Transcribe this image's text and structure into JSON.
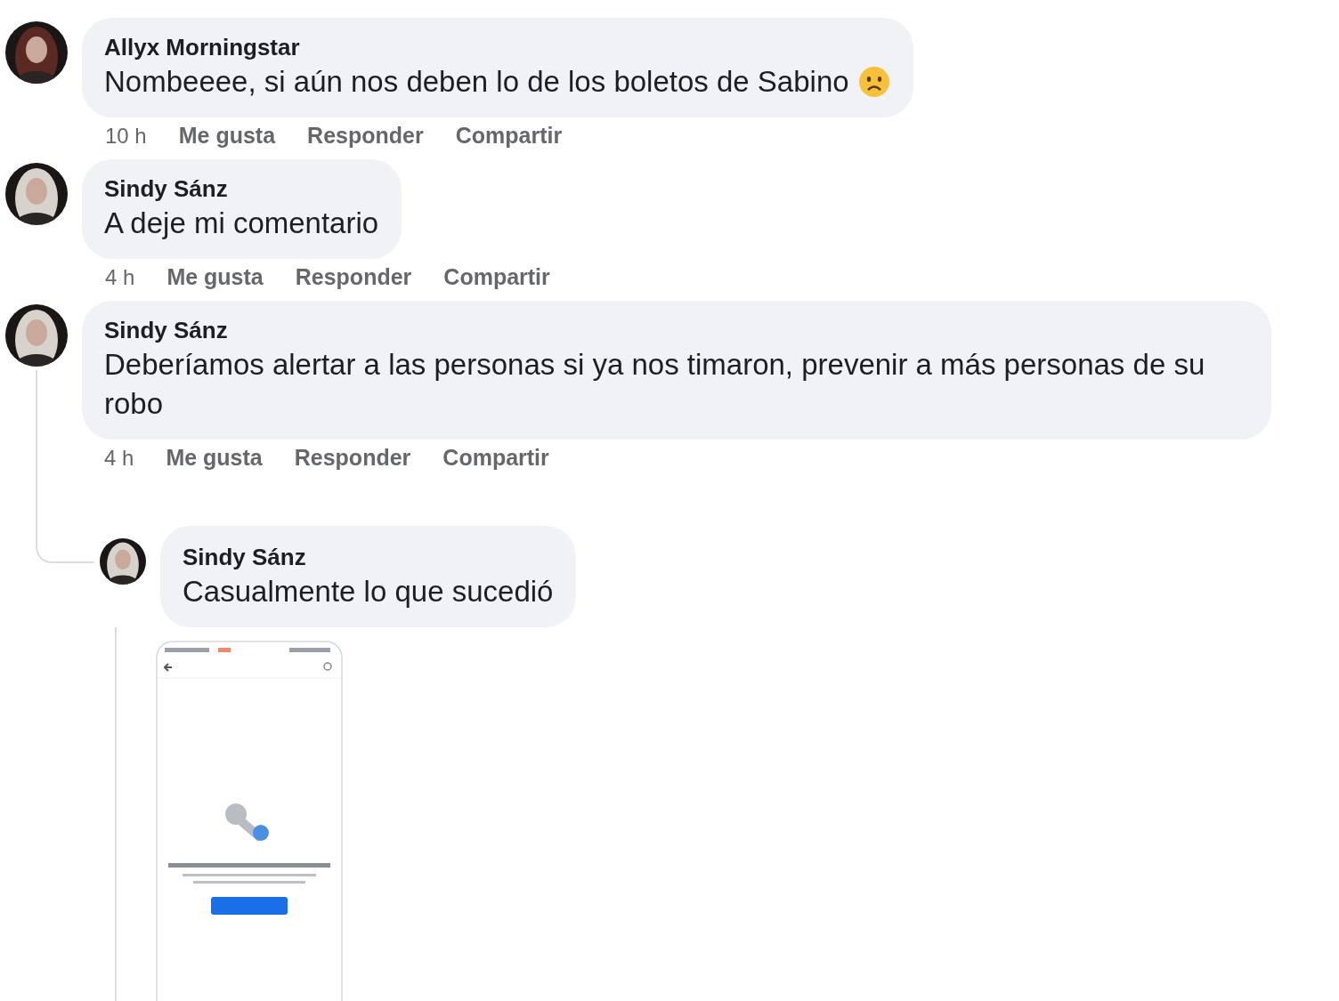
{
  "comments": [
    {
      "author": "Allyx Morningstar",
      "text": "Nombeeee, si aún nos deben lo de los boletos de Sabino",
      "reaction_icon": true,
      "time": "10 h",
      "actions": [
        "Me gusta",
        "Responder",
        "Compartir"
      ]
    },
    {
      "author": "Sindy Sánz",
      "text": "A deje mi comentario",
      "reaction_icon": false,
      "time": "4 h",
      "actions": [
        "Me gusta",
        "Responder",
        "Compartir"
      ]
    },
    {
      "author": "Sindy Sánz",
      "text": "Deberíamos alertar a las personas si ya nos timaron, prevenir a más personas de su robo",
      "reaction_icon": false,
      "time": "4 h",
      "actions": [
        "Me gusta",
        "Responder",
        "Compartir"
      ],
      "replies": [
        {
          "author": "Sindy Sánz",
          "text": "Casualmente lo que sucedió",
          "attachment": {
            "kind": "phone-screenshot"
          }
        }
      ]
    }
  ]
}
